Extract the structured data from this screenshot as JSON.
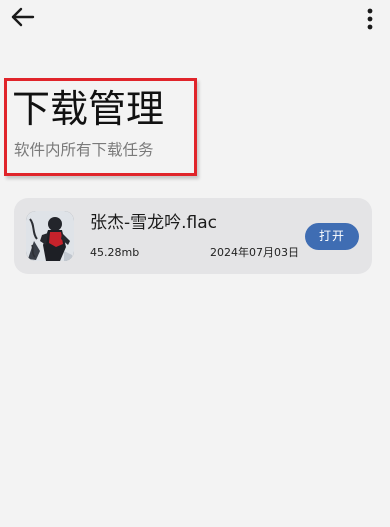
{
  "topbar": {
    "back_icon": "arrow-left-icon",
    "more_icon": "more-vertical-icon"
  },
  "header": {
    "title": "下载管理",
    "subtitle": "软件内所有下载任务",
    "highlight_color": "#e0242a"
  },
  "downloads": [
    {
      "title": "张杰-雪龙吟.flac",
      "size": "45.28mb",
      "date": "2024年07月03日",
      "action_label": "打开",
      "action_color": "#3f6db3"
    }
  ]
}
